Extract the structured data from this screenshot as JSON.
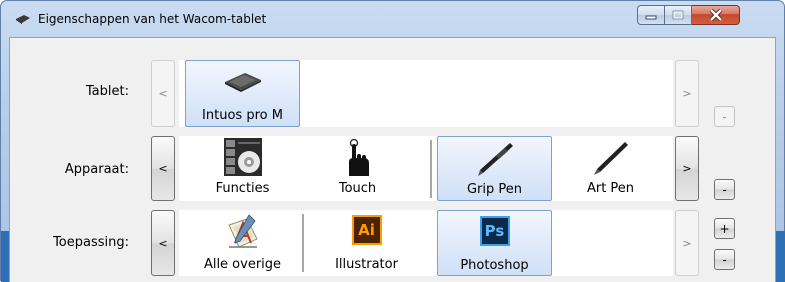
{
  "window": {
    "title": "Eigenschappen van het Wacom-tablet",
    "minimize_icon": "minimize-icon",
    "maximize_icon": "maximize-icon",
    "close_icon": "close-icon"
  },
  "rows": {
    "tablet": {
      "label": "Tablet:",
      "prev": "<",
      "next": ">",
      "remove": "-",
      "items": [
        {
          "label": "Intuos pro M",
          "icon": "tablet-device-icon",
          "selected": true
        }
      ]
    },
    "apparaat": {
      "label": "Apparaat:",
      "prev": "<",
      "next": ">",
      "remove": "-",
      "items": [
        {
          "label": "Functies",
          "icon": "express-keys-icon",
          "selected": false
        },
        {
          "label": "Touch",
          "icon": "touch-hand-icon",
          "selected": false
        },
        {
          "label": "Grip Pen",
          "icon": "grip-pen-icon",
          "selected": true
        },
        {
          "label": "Art Pen",
          "icon": "art-pen-icon",
          "selected": false
        }
      ]
    },
    "toepassing": {
      "label": "Toepassing:",
      "prev": "<",
      "next": ">",
      "add": "+",
      "remove": "-",
      "items": [
        {
          "label": "Alle overige",
          "icon": "all-apps-icon",
          "selected": false
        },
        {
          "label": "Illustrator",
          "icon": "illustrator-icon",
          "icon_text": "Ai",
          "selected": false
        },
        {
          "label": "Photoshop",
          "icon": "photoshop-icon",
          "icon_text": "Ps",
          "selected": true
        }
      ]
    }
  },
  "colors": {
    "selection_border": "#7da2ce",
    "illustrator_bg": "#ff9a00",
    "photoshop_bg": "#1e73c6"
  }
}
